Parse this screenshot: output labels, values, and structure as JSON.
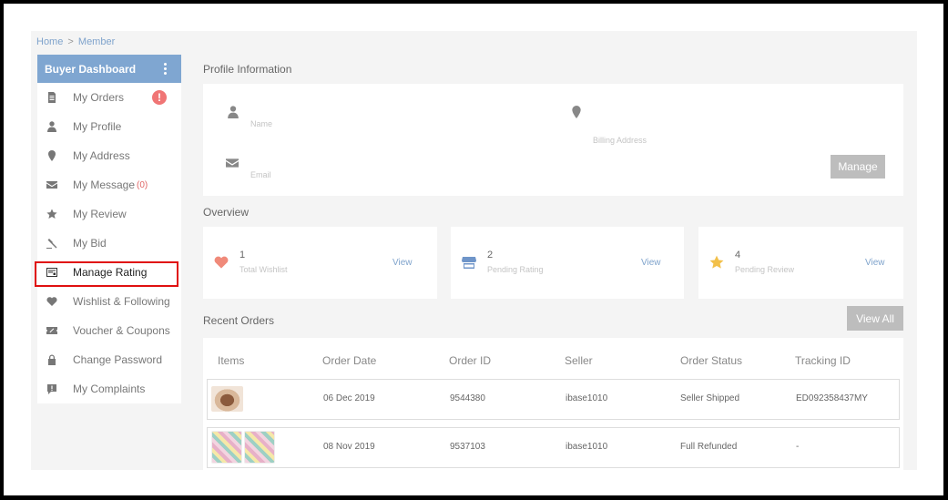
{
  "breadcrumb": {
    "home": "Home",
    "sep": ">",
    "current": "Member"
  },
  "sidebar": {
    "title": "Buyer Dashboard",
    "items": [
      {
        "label": "My Orders",
        "icon": "document-icon",
        "badge": "!"
      },
      {
        "label": "My Profile",
        "icon": "user-icon"
      },
      {
        "label": "My Address",
        "icon": "map-pin-icon"
      },
      {
        "label": "My Message",
        "icon": "envelope-icon",
        "count": "(0)"
      },
      {
        "label": "My Review",
        "icon": "star-icon"
      },
      {
        "label": "My Bid",
        "icon": "gavel-icon"
      },
      {
        "label": "Manage Rating",
        "icon": "rating-icon"
      },
      {
        "label": "Wishlist & Following",
        "icon": "heart-icon"
      },
      {
        "label": "Voucher & Coupons",
        "icon": "voucher-icon"
      },
      {
        "label": "Change Password",
        "icon": "lock-icon"
      },
      {
        "label": "My Complaints",
        "icon": "complaint-icon"
      }
    ]
  },
  "profile": {
    "title": "Profile Information",
    "name_label": "Name",
    "billing_label": "Billing Address",
    "email_label": "Email",
    "manage_label": "Manage"
  },
  "overview": {
    "title": "Overview",
    "cards": [
      {
        "count": "1",
        "label": "Total Wishlist",
        "view": "View",
        "icon": "heart-icon",
        "color": "#f08a7a"
      },
      {
        "count": "2",
        "label": "Pending Rating",
        "view": "View",
        "icon": "store-icon",
        "color": "#6f95c9"
      },
      {
        "count": "4",
        "label": "Pending Review",
        "view": "View",
        "icon": "star-icon",
        "color": "#f2c04a"
      }
    ]
  },
  "orders": {
    "title": "Recent Orders",
    "view_all": "View All",
    "columns": [
      "Items",
      "Order Date",
      "Order ID",
      "Seller",
      "Order Status",
      "Tracking ID"
    ],
    "rows": [
      {
        "date": "06 Dec 2019",
        "id": "9544380",
        "seller": "ibase1010",
        "status": "Seller Shipped",
        "tracking": "ED092358437MY"
      },
      {
        "date": "08 Nov 2019",
        "id": "9537103",
        "seller": "ibase1010",
        "status": "Full Refunded",
        "tracking": "-"
      }
    ]
  }
}
